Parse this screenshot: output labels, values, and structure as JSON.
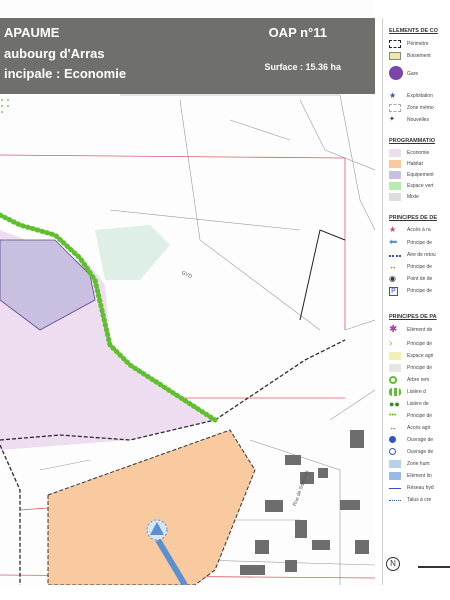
{
  "header": {
    "title_line1": "APAUME",
    "title_line2": "aubourg d'Arras",
    "title_line3": "incipale : Economie",
    "oap_label": "OAP n°11",
    "surface": "Surface : 15.36 ha"
  },
  "map": {
    "road_label_1": "GYD",
    "road_label_2": "Rue de Sancourt"
  },
  "legend": {
    "section_elements": "ELEMENTS DE CO",
    "perimetre": "Périmètre",
    "boisement": "Boisement",
    "gare": "Gare",
    "exploitation": "Exploitation",
    "zone_memoire": "Zone mémo",
    "nouvelles": "Nouvelles",
    "section_programmation": "PROGRAMMATIO",
    "economie": "Economie",
    "habitat": "Habitat",
    "equipement": "Equipement",
    "espace_vert": "Espace vert",
    "mixte": "Mixte",
    "section_desserte": "PRINCIPES DE DE",
    "acces": "Accès à ra",
    "principe_d1": "Principe de",
    "aire_retour": "Aire de retou",
    "principe_d2": "Principe de",
    "point_de": "Point de de",
    "principe_d3": "Principe de",
    "section_paysage": "PRINCIPES DE PA",
    "element_de": "Elément de",
    "principe_p1": "Principe de",
    "espace_agri": "Espace agri",
    "principe_p2": "Principe de",
    "arbre_rem": "Arbre rem",
    "lisiere_1": "Lisière d",
    "lisiere_2": "Lisière de",
    "principe_p3": "Principe de",
    "acces_agri": "Accès agri",
    "ouvrage_1": "Ouvrage de",
    "ouvrage_2": "Ouvrage de",
    "zone_hum": "Zone hum",
    "element_lin": "Elément lin",
    "reseau_hyd": "Réseau hyd",
    "talus_ou": "Talus à cre",
    "north_label": "N"
  },
  "colors": {
    "economy": "#eedcf0",
    "habitat": "#f9c9a0",
    "equipment": "#c9bfe0",
    "green_space": "#b7ecb0",
    "hedge": "#5fbf2c",
    "banner": "#6f6f6c",
    "perimeter": "#2c2c2c"
  }
}
